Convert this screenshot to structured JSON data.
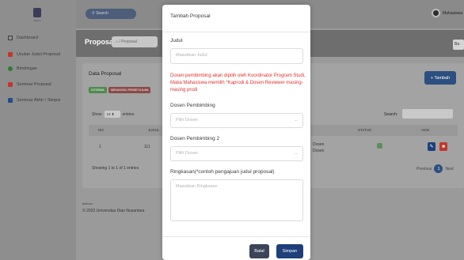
{
  "app": {
    "logo_text": "simpro"
  },
  "topbar": {
    "search_placeholder": "Search",
    "user_name": "Mahasiswa"
  },
  "sidebar": {
    "items": [
      {
        "label": "Dashboard",
        "icon": "monitor-icon",
        "color": "#3d3d3d"
      },
      {
        "label": "Usulan Judul Proposal",
        "icon": "file-icon",
        "color": "#c0392b"
      },
      {
        "label": "Bimbingan",
        "icon": "pin-icon",
        "color": "#2e7d32"
      },
      {
        "label": "Seminar Proposal",
        "icon": "book-icon",
        "color": "#c0392b"
      },
      {
        "label": "Seminar Akhir / Skripsi",
        "icon": "list-icon",
        "color": "#1e4f8c"
      }
    ]
  },
  "page": {
    "title": "Proposal",
    "breadcrumb": "Proposal",
    "corner_button": "Ba"
  },
  "card": {
    "title": "Data Proposal",
    "badges": [
      "DITERIMA",
      "MENUNGGU PERSETUJUAN"
    ],
    "tambah_label": "+ Tambah",
    "show_label": "Show",
    "show_value": "10",
    "entries_label": "entries",
    "search_label": "Search:",
    "columns": [
      "NO",
      "JUDUL",
      "STATUS",
      "AKSI"
    ],
    "rows": [
      {
        "no": "1",
        "judul": "111",
        "dosen_1": "Dosen",
        "dosen_2": "Dosen"
      }
    ],
    "showing_text": "Showing 1 to 1 of 1 entries",
    "previous_label": "Previous",
    "page_number": "1",
    "next_label": "Next"
  },
  "footer": {
    "small_text": "Bantuan",
    "copyright": "© 2023 Universitas Dian Nusantara"
  },
  "modal": {
    "title": "Tambah Proposal",
    "judul_label": "Judul",
    "judul_placeholder": "Masukkan Judul",
    "note": "Dosen pembimbing akan dipilih oleh Koordinator Program Studi, Maka Mahasiswa memilih *Kaprodi & Dosen Reviewer masing-masing prodi",
    "pembimbing_label": "Dosen Pembimbing",
    "pembimbing_value": "Pilih Dosen",
    "pembimbing2_label": "Dosen Pembimbing 2",
    "pembimbing2_value": "Pilih Dosen",
    "ringkasan_label": "Ringkasan(*contoh pengajuan judul proposal)",
    "ringkasan_placeholder": "Masukkan Ringkasan",
    "batal_label": "Batal",
    "simpan_label": "Simpan"
  },
  "colors": {
    "primary": "#1e4f8c",
    "danger": "#e03030",
    "success": "#3aa845",
    "batal_bg": "#3c4458",
    "simpan_bg": "#1e3f7a"
  }
}
